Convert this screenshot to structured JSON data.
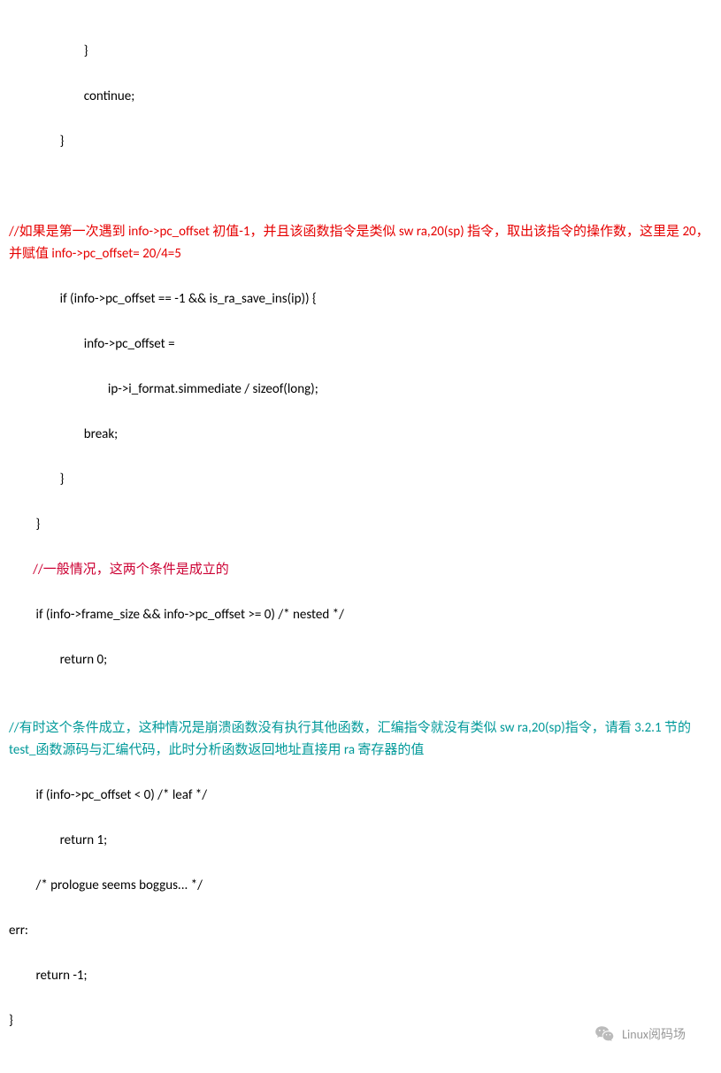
{
  "lines": {
    "l1": "                         }",
    "l2": "                         continue;",
    "l3": "                 }",
    "blank1": "",
    "blank2": "",
    "red_comment": "       //如果是第一次遇到 info->pc_offset 初值-1，并且该函数指令是类似 sw      ra,20(sp)  指令，取出该指令的操作数，这里是 20，并赋值 info->pc_offset= 20/4=5",
    "l4": "                 if (info->pc_offset == -1 && is_ra_save_ins(ip)) {",
    "l5": "                         info->pc_offset =",
    "l6": "                                 ip->i_format.simmediate / sizeof(long);",
    "l7": "                         break;",
    "l8": "                 }",
    "l9": "         }",
    "darkred_comment": "        //一般情况，这两个条件是成立的",
    "l10": "         if (info->frame_size && info->pc_offset >= 0) /* nested */",
    "l11": "                 return 0;",
    "blank3": "",
    "teal_comment": "        //有时这个条件成立，这种情况是崩溃函数没有执行其他函数，汇编指令就没有类似 sw      ra,20(sp)指令，请看 3.2.1 节的 test_函数源码与汇编代码，此时分析函数返回地址直接用 ra 寄存器的值",
    "l12": "         if (info->pc_offset < 0) /* leaf */",
    "l13": "                 return 1;",
    "l14": "         /* prologue seems boggus... */",
    "l15": "err:",
    "l16": "         return -1;",
    "l17": "}"
  },
  "watermark": {
    "text": "Linux阅码场"
  }
}
